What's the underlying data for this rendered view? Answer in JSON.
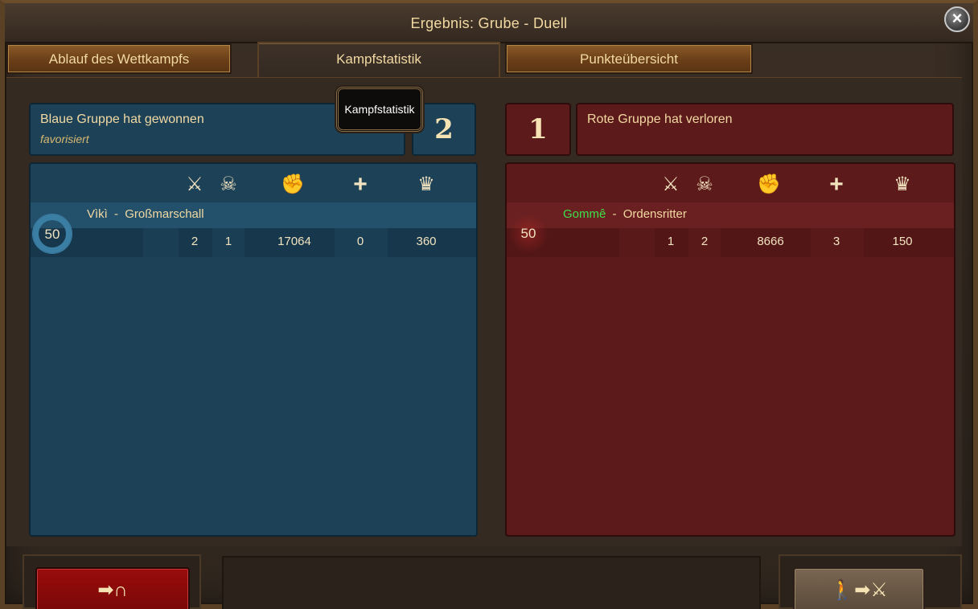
{
  "window": {
    "title": "Ergebnis: Grube - Duell",
    "close_icon": "×"
  },
  "tabs": [
    {
      "label": "Ablauf des Wettkampfs",
      "active": false
    },
    {
      "label": "Kampfstatistik",
      "active": true
    },
    {
      "label": "Punkteübersicht",
      "active": false
    }
  ],
  "tooltip": "Kampfstatistik",
  "columns": [
    {
      "icon": "crossed-swords-icon",
      "glyph": "⚔"
    },
    {
      "icon": "skull-icon",
      "glyph": "☠"
    },
    {
      "icon": "fist-icon",
      "glyph": "✊"
    },
    {
      "icon": "plus-icon",
      "glyph": "+"
    },
    {
      "icon": "crown-icon",
      "glyph": "♛"
    }
  ],
  "blue": {
    "result": "Blaue Gruppe hat gewonnen",
    "subtitle": "favorisiert",
    "score": "2",
    "player": {
      "name": "Vìkì",
      "sep": "-",
      "title": "Großmarschall",
      "level": "50",
      "stats": [
        "2",
        "1",
        "17064",
        "0",
        "360"
      ]
    }
  },
  "red": {
    "result": "Rote Gruppe hat verloren",
    "score": "1",
    "player": {
      "name": "Gommê",
      "sep": "-",
      "title": "Ordensritter",
      "level": "50",
      "stats": [
        "1",
        "2",
        "8666",
        "3",
        "150"
      ]
    }
  },
  "buttons": {
    "leave": "➡∩",
    "next": "🚶➡⚔"
  },
  "colors": {
    "blue_team": "#1d4258",
    "red_team": "#5c1a1a",
    "red_player_name": "#3ee04a"
  }
}
